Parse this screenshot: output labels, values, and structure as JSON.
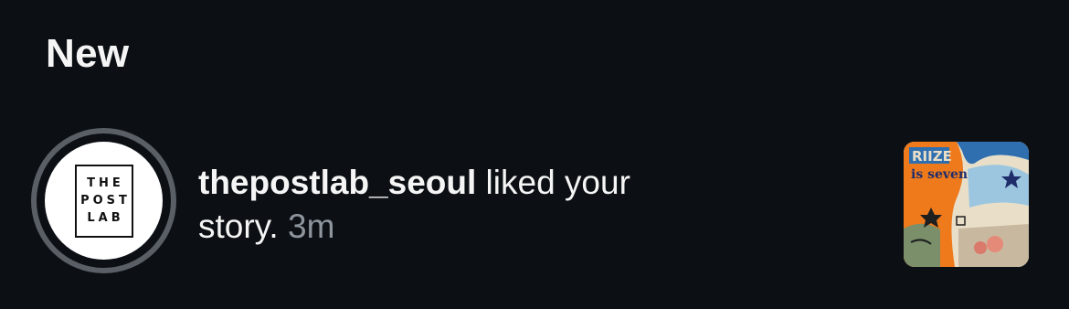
{
  "section": {
    "title": "New"
  },
  "notification": {
    "username": "thepostlab_seoul",
    "action": " liked your story.",
    "time": "3m",
    "avatar": {
      "logo_lines": [
        "THE",
        "POST",
        "LAB"
      ]
    },
    "thumbnail": {
      "text_top": "RIIZE",
      "text_mid": "is seven"
    }
  },
  "colors": {
    "background": "#0c1014",
    "text": "#f5f5f5",
    "muted": "#8e959d",
    "ring": "#5a5f66"
  }
}
